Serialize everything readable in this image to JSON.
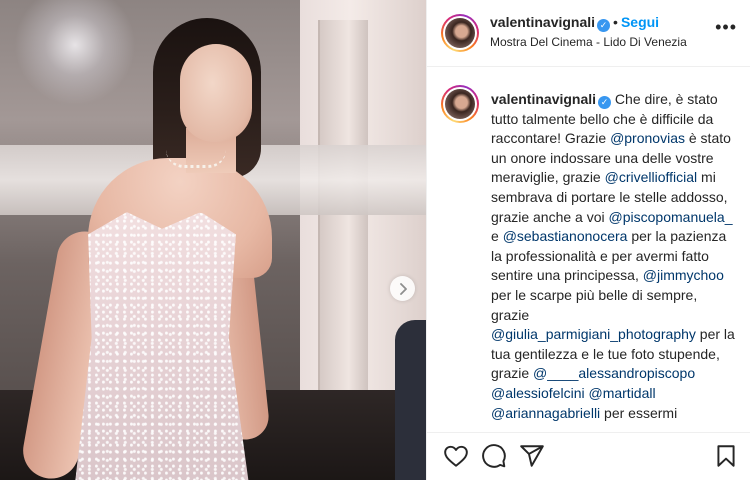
{
  "post": {
    "username": "valentinavignali",
    "follow_label": "Segui",
    "separator": "•",
    "location": "Mostra Del Cinema - Lido Di Venezia",
    "more_label": "•••"
  },
  "caption": {
    "username": "valentinavignali",
    "segments": [
      {
        "type": "text",
        "value": " Che dire, è stato tutto talmente bello che è difficile da raccontare! Grazie "
      },
      {
        "type": "mention",
        "value": "@pronovias"
      },
      {
        "type": "text",
        "value": " è stato un onore indossare una delle vostre meraviglie, grazie "
      },
      {
        "type": "mention",
        "value": "@crivelliofficial"
      },
      {
        "type": "text",
        "value": " mi sembrava di portare le stelle addosso, grazie anche a voi "
      },
      {
        "type": "mention",
        "value": "@piscopomanuela_"
      },
      {
        "type": "text",
        "value": " e "
      },
      {
        "type": "mention",
        "value": "@sebastianonocera"
      },
      {
        "type": "text",
        "value": " per la pazienza la professionalità e per avermi fatto sentire una principessa, "
      },
      {
        "type": "mention",
        "value": "@jimmychoo"
      },
      {
        "type": "text",
        "value": " per le scarpe più belle di sempre, grazie "
      },
      {
        "type": "mention",
        "value": "@giulia_parmigiani_photography"
      },
      {
        "type": "text",
        "value": " per la tua gentilezza e le tue foto stupende, grazie "
      },
      {
        "type": "mention",
        "value": "@____alessandropiscopo"
      },
      {
        "type": "text",
        "value": " "
      },
      {
        "type": "mention",
        "value": "@alessiofelcini"
      },
      {
        "type": "text",
        "value": " "
      },
      {
        "type": "mention",
        "value": "@martidall"
      },
      {
        "type": "text",
        "value": " "
      },
      {
        "type": "mention",
        "value": "@ariannagabrielli"
      },
      {
        "type": "text",
        "value": " per essermi"
      }
    ]
  },
  "actions": {
    "icons": [
      "heart-icon",
      "comment-icon",
      "share-icon",
      "bookmark-icon"
    ]
  },
  "colors": {
    "accent": "#0095f6",
    "mention": "#00376b",
    "verified": "#3897f0"
  }
}
